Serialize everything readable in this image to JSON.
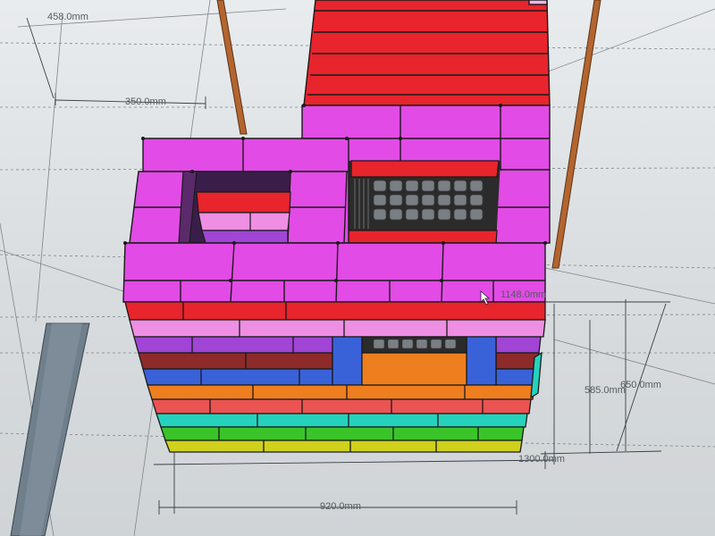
{
  "viewport": {
    "background_top": "#e9ecee",
    "background_bottom": "#cfd4d7"
  },
  "dimensions": {
    "d1": "458.0mm",
    "d2": "350.0mm",
    "d3": "1148.0mm",
    "d4": "585.0mm",
    "d5": "650.0mm",
    "d6": "1300.0mm",
    "d7": "920.0mm"
  },
  "colors": {
    "red": "#e8242c",
    "magenta": "#e24be6",
    "pink": "#ee8fe3",
    "purple": "#a045d6",
    "brown": "#8e2a2a",
    "blue": "#3a62d8",
    "orange": "#ef7f1e",
    "salmon": "#ec5353",
    "teal": "#25d3bd",
    "green": "#3bc42a",
    "yellow": "#cfd11c",
    "wood": "#b4652f",
    "grate": "#6a6f74",
    "pillar": "#6f7f8c"
  },
  "icons": {
    "cursor": "mouse-pointer-icon"
  }
}
